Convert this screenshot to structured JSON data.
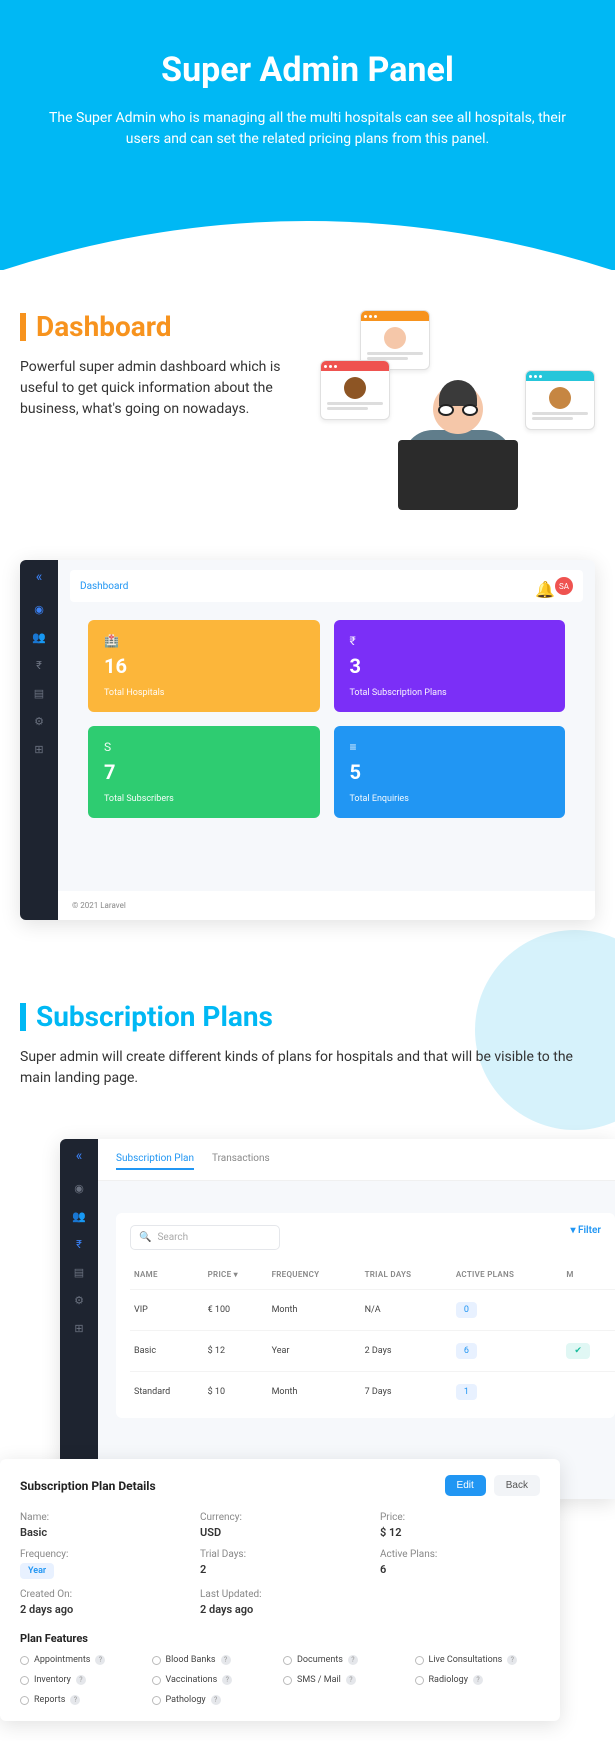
{
  "hero": {
    "title": "Super Admin Panel",
    "subtitle": "The Super Admin who is managing all the multi hospitals can see all hospitals, their users and can set the related pricing plans from this panel."
  },
  "dashboard_section": {
    "title": "Dashboard",
    "desc": "Powerful super admin dashboard which is useful to get quick information about the business, what's going on nowadays."
  },
  "dash_app": {
    "breadcrumb": "Dashboard",
    "avatar": "SA",
    "stats": {
      "hospitals": {
        "icon": "🏥",
        "value": "16",
        "label": "Total Hospitals"
      },
      "plans": {
        "icon": "₹",
        "value": "3",
        "label": "Total Subscription Plans"
      },
      "subs": {
        "icon": "S",
        "value": "7",
        "label": "Total Subscribers"
      },
      "enq": {
        "icon": "≡",
        "value": "5",
        "label": "Total Enquiries"
      }
    },
    "footer": "© 2021 Laravel"
  },
  "subs_section": {
    "title": "Subscription Plans",
    "desc": "Super admin will create different kinds of plans for hospitals and that will be visible to the main landing page."
  },
  "subs_app": {
    "tabs": {
      "a": "Subscription Plan",
      "b": "Transactions"
    },
    "search_placeholder": "Search",
    "filter": "Filter",
    "cols": {
      "name": "NAME",
      "price": "PRICE",
      "freq": "FREQUENCY",
      "trial": "TRIAL DAYS",
      "active": "ACTIVE PLANS",
      "m": "M"
    },
    "rows": {
      "r0": {
        "name": "VIP",
        "price": "€ 100",
        "freq": "Month",
        "trial": "N/A",
        "active": "0"
      },
      "r1": {
        "name": "Basic",
        "price": "$ 12",
        "freq": "Year",
        "trial": "2 Days",
        "active": "6"
      },
      "r2": {
        "name": "Standard",
        "price": "$ 10",
        "freq": "Month",
        "trial": "7 Days",
        "active": "1"
      }
    }
  },
  "detail": {
    "title": "Subscription Plan Details",
    "edit": "Edit",
    "back": "Back",
    "kv": {
      "name_k": "Name:",
      "name_v": "Basic",
      "curr_k": "Currency:",
      "curr_v": "USD",
      "price_k": "Price:",
      "price_v": "$ 12",
      "freq_k": "Frequency:",
      "freq_v": "Year",
      "trial_k": "Trial Days:",
      "trial_v": "2",
      "active_k": "Active Plans:",
      "active_v": "6",
      "created_k": "Created On:",
      "created_v": "2 days ago",
      "updated_k": "Last Updated:",
      "updated_v": "2 days ago"
    },
    "features_title": "Plan Features",
    "features": {
      "f0": "Appointments",
      "f1": "Blood Banks",
      "f2": "Documents",
      "f3": "Live Consultations",
      "f4": "Inventory",
      "f5": "Vaccinations",
      "f6": "SMS / Mail",
      "f7": "Radiology",
      "f8": "Reports",
      "f9": "Pathology"
    }
  }
}
